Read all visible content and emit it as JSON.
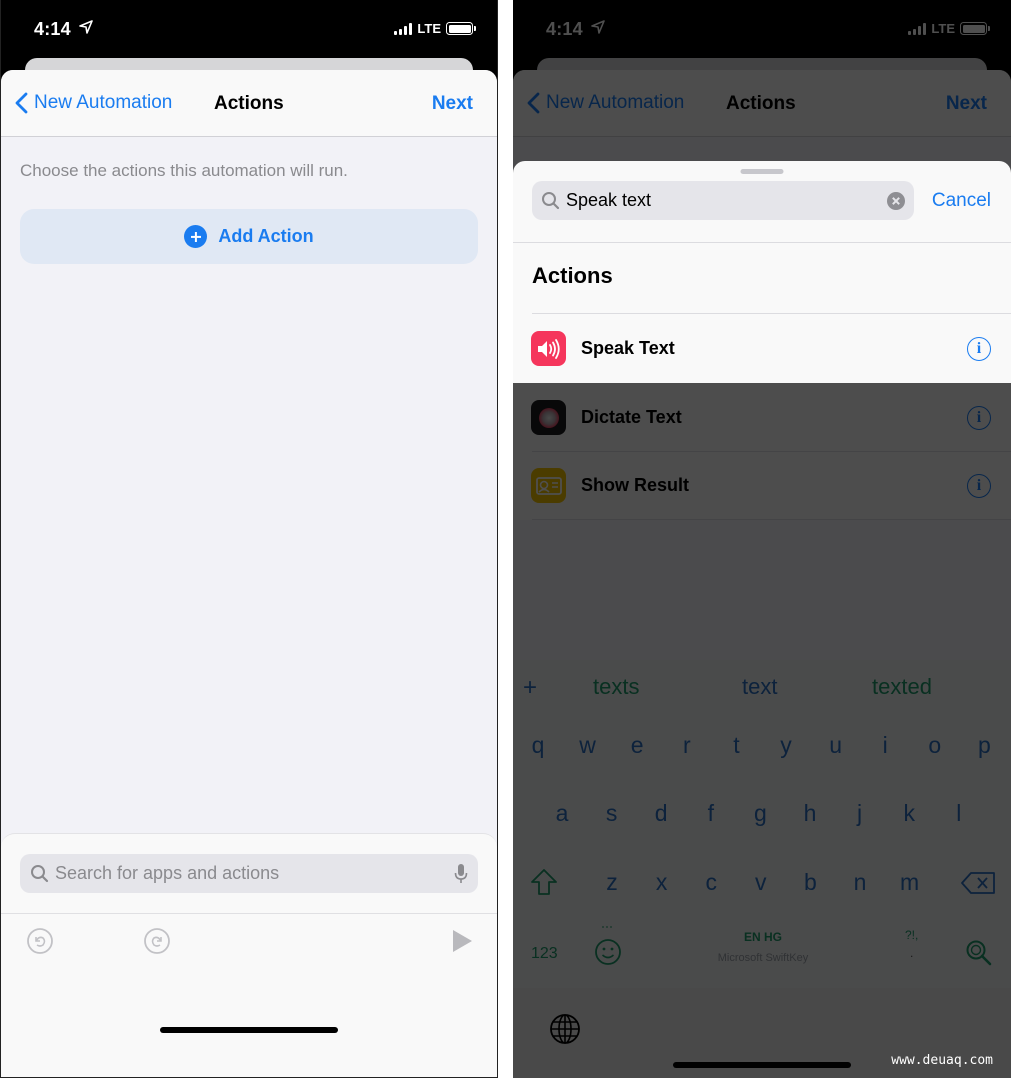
{
  "left_screen": {
    "status": {
      "time": "4:14",
      "network": "LTE",
      "location_icon": "location-arrow-icon",
      "signal_bars": 4,
      "battery_percent": 100
    },
    "nav": {
      "back_label": "New Automation",
      "title": "Actions",
      "next_label": "Next"
    },
    "hint": "Choose the actions this automation will run.",
    "add_action_label": "Add Action",
    "search": {
      "placeholder": "Search for apps and actions",
      "value": ""
    },
    "toolbar": {
      "undo_icon": "undo-icon",
      "redo_icon": "redo-icon",
      "play_icon": "play-icon"
    },
    "colors": {
      "accent": "#1a7cf0",
      "background": "#f2f2f7",
      "add_button_bg": "#e0e8f4"
    }
  },
  "right_screen": {
    "status": {
      "time": "4:14",
      "network": "LTE",
      "signal_bars": 4
    },
    "nav": {
      "back_label": "New Automation",
      "title": "Actions",
      "next_label": "Next"
    },
    "search": {
      "value": "Speak text",
      "cancel_label": "Cancel"
    },
    "section_title": "Actions",
    "results": [
      {
        "label": "Speak Text",
        "icon": "speaker-icon",
        "icon_color": "#f5365c",
        "highlighted": true
      },
      {
        "label": "Dictate Text",
        "icon": "dictate-icon",
        "icon_color": "#1c1c1e",
        "highlighted": false
      },
      {
        "label": "Show Result",
        "icon": "show-result-icon",
        "icon_color": "#f2c200",
        "highlighted": false
      }
    ],
    "keyboard": {
      "suggestions": [
        "texts",
        "text",
        "texted"
      ],
      "add_symbol": "+",
      "row1": [
        "q",
        "w",
        "e",
        "r",
        "t",
        "y",
        "u",
        "i",
        "o",
        "p"
      ],
      "row2": [
        "a",
        "s",
        "d",
        "f",
        "g",
        "h",
        "j",
        "k",
        "l"
      ],
      "row3": [
        "z",
        "x",
        "c",
        "v",
        "b",
        "n",
        "m"
      ],
      "numbers_key": "123",
      "space_label": "EN HG",
      "space_sublabel": "Microsoft SwiftKey",
      "punct_key": "?!,",
      "period_key": "."
    }
  },
  "watermark": "www.deuaq.com"
}
